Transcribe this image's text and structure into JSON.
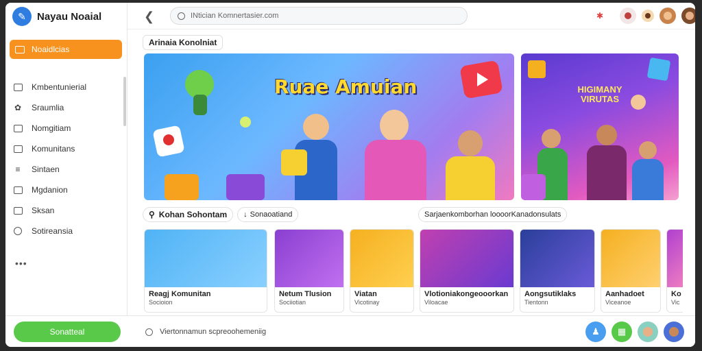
{
  "app": {
    "name": "Nayau Noaial"
  },
  "sidebar": {
    "active_item": "Noaidlcias",
    "items": [
      {
        "label": "Kmbentunierial",
        "icon": "box"
      },
      {
        "label": "Sraumlia",
        "icon": "leaf"
      },
      {
        "label": "Nomgitiam",
        "icon": "box"
      },
      {
        "label": "Komunitans",
        "icon": "box"
      },
      {
        "label": "Sintaen",
        "icon": "layers"
      },
      {
        "label": "Mgdanion",
        "icon": "box"
      },
      {
        "label": "Sksan",
        "icon": "box"
      },
      {
        "label": "Sotireansia",
        "icon": "circle"
      }
    ],
    "more_label": "•••"
  },
  "header": {
    "back_icon": "chevron-left-icon",
    "search_placeholder": "INtician Komnertasier.com"
  },
  "section": {
    "title": "Arinaia Konolniat"
  },
  "hero": {
    "main_title": "Ruae Amuian",
    "side_title": "HIGIMANY VIRUTAS"
  },
  "filters": {
    "primary": "Kohan Sohontam",
    "secondary": "Sonaoatiand",
    "right": "Sarjaenkomborhan loooorKanadonsulats"
  },
  "cards": [
    {
      "title": "Reagj Komunitan",
      "subtitle": "Socioion",
      "colors": [
        "#4fb3f5",
        "#8ad0ff"
      ]
    },
    {
      "title": "Netum Tlusion",
      "subtitle": "Sociiotian",
      "colors": [
        "#8a3fd0",
        "#c070f0"
      ]
    },
    {
      "title": "Viatan",
      "subtitle": "Vicotinay",
      "colors": [
        "#f5b020",
        "#ffd050"
      ]
    },
    {
      "title": "Vlotioniakongeooorkan",
      "subtitle": "Viloacae",
      "colors": [
        "#c040b0",
        "#6a3ad0"
      ]
    },
    {
      "title": "Aongsutiklaks",
      "subtitle": "Tientonn",
      "colors": [
        "#2a3f9a",
        "#6a5ad8"
      ]
    },
    {
      "title": "Aanhadoet",
      "subtitle": "Viceanoe",
      "colors": [
        "#f5b020",
        "#ffd070"
      ]
    },
    {
      "title": "Ko",
      "subtitle": "Vic",
      "colors": [
        "#b040d0",
        "#f080c0"
      ]
    }
  ],
  "bottom": {
    "button_label": "Sonatteal",
    "search_text": "Viertonnamun scpreoohemeniig"
  },
  "colors": {
    "accent": "#f7921e",
    "green": "#59c94a",
    "blue": "#2f7de1"
  }
}
